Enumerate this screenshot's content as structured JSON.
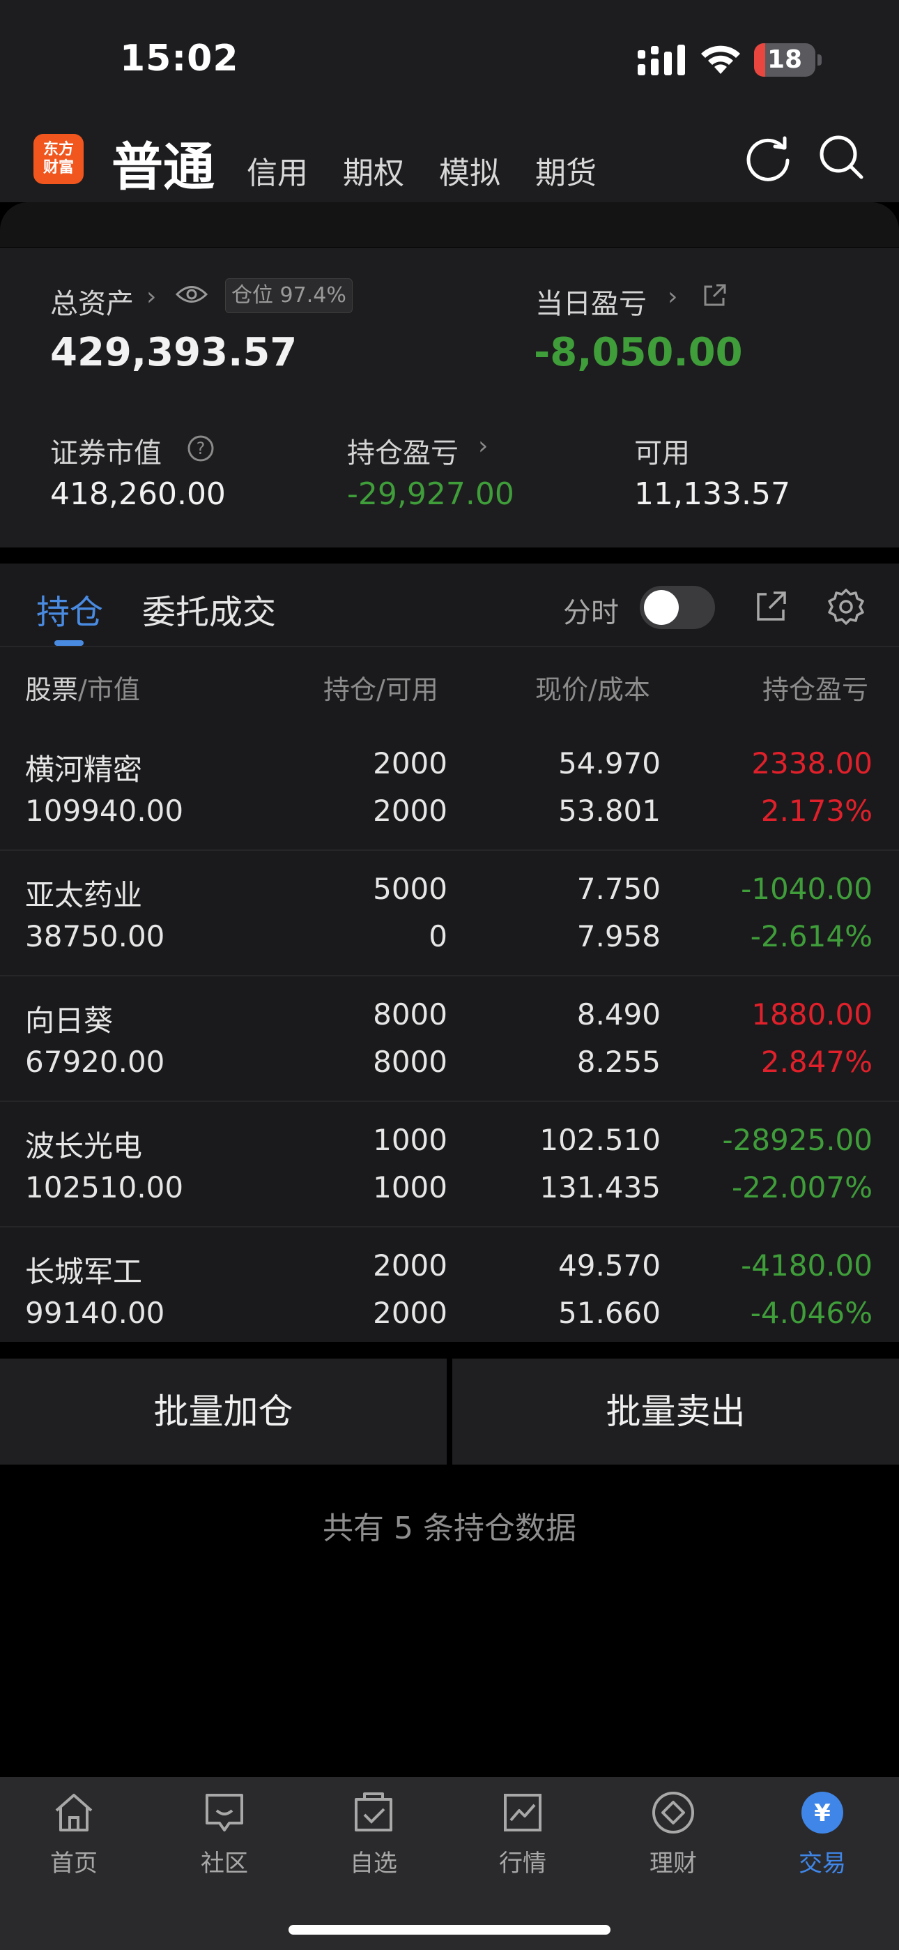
{
  "status_bar": {
    "time": "15:02",
    "battery": "18",
    "battery_level": 0.18
  },
  "nav": {
    "logo_line1": "东方",
    "logo_line2": "财富",
    "active": "普通",
    "tabs": [
      "信用",
      "期权",
      "模拟",
      "期货"
    ]
  },
  "summary": {
    "total_assets_label": "总资产",
    "total_assets": "429,393.57",
    "position_ratio": "仓位 97.4%",
    "daily_pnl_label": "当日盈亏",
    "daily_pnl": "-8,050.00",
    "market_value_label": "证券市值",
    "market_value": "418,260.00",
    "holding_pnl_label": "持仓盈亏",
    "holding_pnl": "-29,927.00",
    "available_label": "可用",
    "available": "11,133.57"
  },
  "holdings": {
    "tab_active": "持仓",
    "tab_other": "委托成交",
    "fenshi_label": "分时",
    "header": {
      "stock": "股票",
      "stock_sub": "/市值",
      "qty": "持仓",
      "qty_sub": "/可用",
      "price": "现价",
      "price_sub": "/成本",
      "pnl": "持仓盈亏"
    },
    "rows": [
      {
        "name": "横河精密",
        "market_value": "109940.00",
        "qty": "2000",
        "avail": "2000",
        "price": "54.970",
        "cost": "53.801",
        "pnl": "2338.00",
        "pnl_pct": "2.173%",
        "trend": "up"
      },
      {
        "name": "亚太药业",
        "market_value": "38750.00",
        "qty": "5000",
        "avail": "0",
        "price": "7.750",
        "cost": "7.958",
        "pnl": "-1040.00",
        "pnl_pct": "-2.614%",
        "trend": "down"
      },
      {
        "name": "向日葵",
        "market_value": "67920.00",
        "qty": "8000",
        "avail": "8000",
        "price": "8.490",
        "cost": "8.255",
        "pnl": "1880.00",
        "pnl_pct": "2.847%",
        "trend": "up"
      },
      {
        "name": "波长光电",
        "market_value": "102510.00",
        "qty": "1000",
        "avail": "1000",
        "price": "102.510",
        "cost": "131.435",
        "pnl": "-28925.00",
        "pnl_pct": "-22.007%",
        "trend": "down"
      },
      {
        "name": "长城军工",
        "market_value": "99140.00",
        "qty": "2000",
        "avail": "2000",
        "price": "49.570",
        "cost": "51.660",
        "pnl": "-4180.00",
        "pnl_pct": "-4.046%",
        "trend": "down"
      }
    ]
  },
  "actions": {
    "batch_buy": "批量加仓",
    "batch_sell": "批量卖出",
    "total_note": "共有 5 条持仓数据"
  },
  "tabbar": {
    "items": [
      {
        "label": "首页",
        "icon": "home-icon"
      },
      {
        "label": "社区",
        "icon": "community-icon"
      },
      {
        "label": "自选",
        "icon": "watchlist-icon"
      },
      {
        "label": "行情",
        "icon": "market-icon"
      },
      {
        "label": "理财",
        "icon": "wealth-icon"
      },
      {
        "label": "交易",
        "icon": "trade-icon"
      }
    ],
    "active_index": 5
  },
  "colors": {
    "up": "#e0202a",
    "down": "#3f9d3a",
    "accent": "#4a8be2",
    "brand": "#f0561e"
  }
}
